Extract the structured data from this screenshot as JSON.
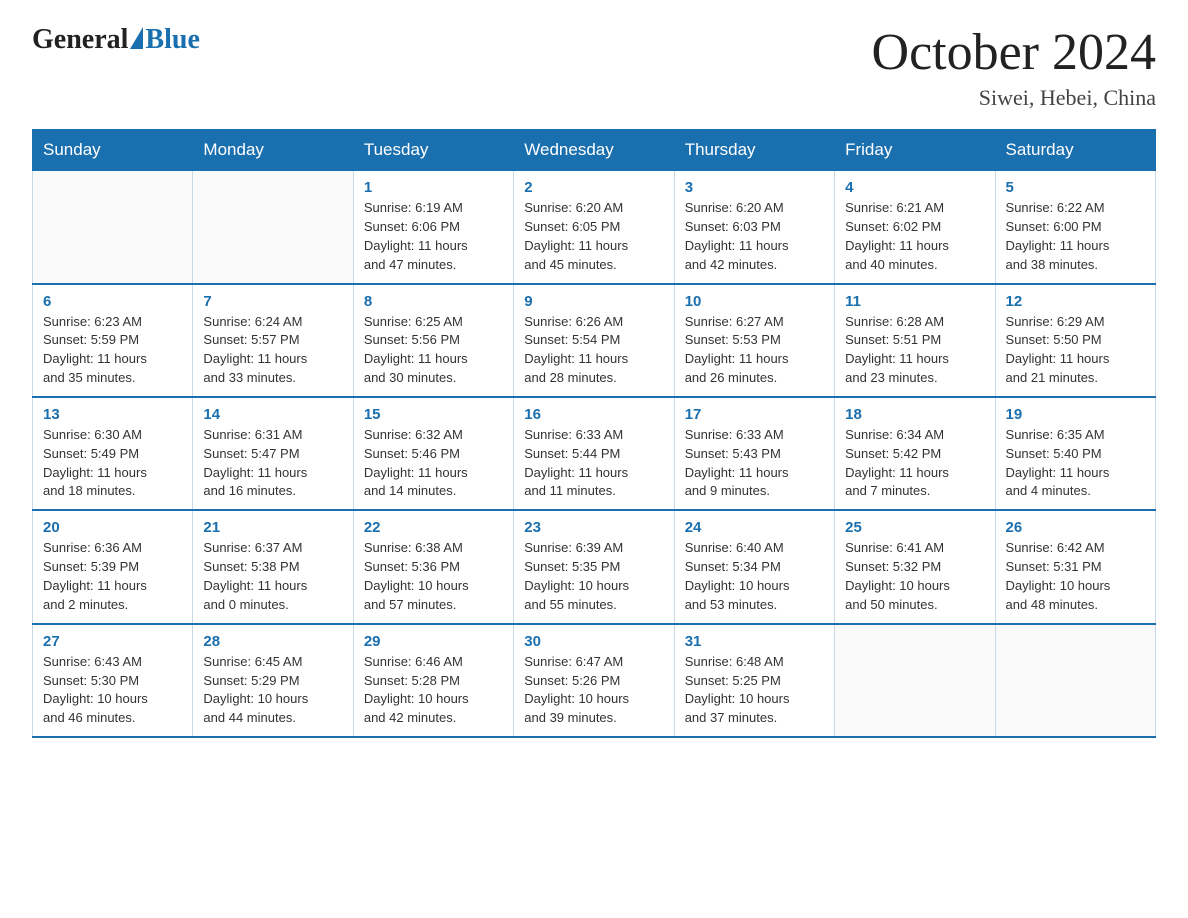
{
  "logo": {
    "general": "General",
    "blue": "Blue"
  },
  "title": "October 2024",
  "subtitle": "Siwei, Hebei, China",
  "days_header": [
    "Sunday",
    "Monday",
    "Tuesday",
    "Wednesday",
    "Thursday",
    "Friday",
    "Saturday"
  ],
  "weeks": [
    [
      {
        "day": "",
        "info": ""
      },
      {
        "day": "",
        "info": ""
      },
      {
        "day": "1",
        "info": "Sunrise: 6:19 AM\nSunset: 6:06 PM\nDaylight: 11 hours\nand 47 minutes."
      },
      {
        "day": "2",
        "info": "Sunrise: 6:20 AM\nSunset: 6:05 PM\nDaylight: 11 hours\nand 45 minutes."
      },
      {
        "day": "3",
        "info": "Sunrise: 6:20 AM\nSunset: 6:03 PM\nDaylight: 11 hours\nand 42 minutes."
      },
      {
        "day": "4",
        "info": "Sunrise: 6:21 AM\nSunset: 6:02 PM\nDaylight: 11 hours\nand 40 minutes."
      },
      {
        "day": "5",
        "info": "Sunrise: 6:22 AM\nSunset: 6:00 PM\nDaylight: 11 hours\nand 38 minutes."
      }
    ],
    [
      {
        "day": "6",
        "info": "Sunrise: 6:23 AM\nSunset: 5:59 PM\nDaylight: 11 hours\nand 35 minutes."
      },
      {
        "day": "7",
        "info": "Sunrise: 6:24 AM\nSunset: 5:57 PM\nDaylight: 11 hours\nand 33 minutes."
      },
      {
        "day": "8",
        "info": "Sunrise: 6:25 AM\nSunset: 5:56 PM\nDaylight: 11 hours\nand 30 minutes."
      },
      {
        "day": "9",
        "info": "Sunrise: 6:26 AM\nSunset: 5:54 PM\nDaylight: 11 hours\nand 28 minutes."
      },
      {
        "day": "10",
        "info": "Sunrise: 6:27 AM\nSunset: 5:53 PM\nDaylight: 11 hours\nand 26 minutes."
      },
      {
        "day": "11",
        "info": "Sunrise: 6:28 AM\nSunset: 5:51 PM\nDaylight: 11 hours\nand 23 minutes."
      },
      {
        "day": "12",
        "info": "Sunrise: 6:29 AM\nSunset: 5:50 PM\nDaylight: 11 hours\nand 21 minutes."
      }
    ],
    [
      {
        "day": "13",
        "info": "Sunrise: 6:30 AM\nSunset: 5:49 PM\nDaylight: 11 hours\nand 18 minutes."
      },
      {
        "day": "14",
        "info": "Sunrise: 6:31 AM\nSunset: 5:47 PM\nDaylight: 11 hours\nand 16 minutes."
      },
      {
        "day": "15",
        "info": "Sunrise: 6:32 AM\nSunset: 5:46 PM\nDaylight: 11 hours\nand 14 minutes."
      },
      {
        "day": "16",
        "info": "Sunrise: 6:33 AM\nSunset: 5:44 PM\nDaylight: 11 hours\nand 11 minutes."
      },
      {
        "day": "17",
        "info": "Sunrise: 6:33 AM\nSunset: 5:43 PM\nDaylight: 11 hours\nand 9 minutes."
      },
      {
        "day": "18",
        "info": "Sunrise: 6:34 AM\nSunset: 5:42 PM\nDaylight: 11 hours\nand 7 minutes."
      },
      {
        "day": "19",
        "info": "Sunrise: 6:35 AM\nSunset: 5:40 PM\nDaylight: 11 hours\nand 4 minutes."
      }
    ],
    [
      {
        "day": "20",
        "info": "Sunrise: 6:36 AM\nSunset: 5:39 PM\nDaylight: 11 hours\nand 2 minutes."
      },
      {
        "day": "21",
        "info": "Sunrise: 6:37 AM\nSunset: 5:38 PM\nDaylight: 11 hours\nand 0 minutes."
      },
      {
        "day": "22",
        "info": "Sunrise: 6:38 AM\nSunset: 5:36 PM\nDaylight: 10 hours\nand 57 minutes."
      },
      {
        "day": "23",
        "info": "Sunrise: 6:39 AM\nSunset: 5:35 PM\nDaylight: 10 hours\nand 55 minutes."
      },
      {
        "day": "24",
        "info": "Sunrise: 6:40 AM\nSunset: 5:34 PM\nDaylight: 10 hours\nand 53 minutes."
      },
      {
        "day": "25",
        "info": "Sunrise: 6:41 AM\nSunset: 5:32 PM\nDaylight: 10 hours\nand 50 minutes."
      },
      {
        "day": "26",
        "info": "Sunrise: 6:42 AM\nSunset: 5:31 PM\nDaylight: 10 hours\nand 48 minutes."
      }
    ],
    [
      {
        "day": "27",
        "info": "Sunrise: 6:43 AM\nSunset: 5:30 PM\nDaylight: 10 hours\nand 46 minutes."
      },
      {
        "day": "28",
        "info": "Sunrise: 6:45 AM\nSunset: 5:29 PM\nDaylight: 10 hours\nand 44 minutes."
      },
      {
        "day": "29",
        "info": "Sunrise: 6:46 AM\nSunset: 5:28 PM\nDaylight: 10 hours\nand 42 minutes."
      },
      {
        "day": "30",
        "info": "Sunrise: 6:47 AM\nSunset: 5:26 PM\nDaylight: 10 hours\nand 39 minutes."
      },
      {
        "day": "31",
        "info": "Sunrise: 6:48 AM\nSunset: 5:25 PM\nDaylight: 10 hours\nand 37 minutes."
      },
      {
        "day": "",
        "info": ""
      },
      {
        "day": "",
        "info": ""
      }
    ]
  ]
}
